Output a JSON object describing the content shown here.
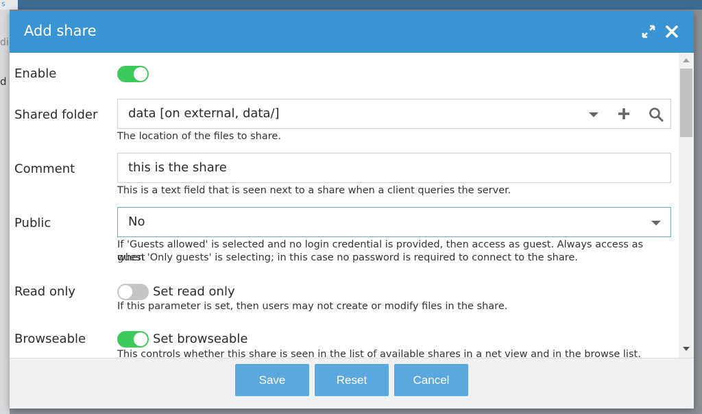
{
  "background": {
    "tab_fragment": "s",
    "side_text_1": "di",
    "side_text_2": "d"
  },
  "dialog": {
    "title": "Add share"
  },
  "form": {
    "enable": {
      "label": "Enable",
      "checked": true
    },
    "shared_folder": {
      "label": "Shared folder",
      "value": "data [on external, data/]",
      "help": "The location of the files to share."
    },
    "comment": {
      "label": "Comment",
      "value": "this is the share",
      "help": "This is a text field that is seen next to a share when a client queries the server."
    },
    "public": {
      "label": "Public",
      "value": "No",
      "help_line1": "If 'Guests allowed' is selected and no login credential is provided, then access as guest. Always access as guest",
      "help_line2": "when 'Only guests' is selecting; in this case no password is required to connect to the share."
    },
    "read_only": {
      "label": "Read only",
      "toggle_text": "Set read only",
      "checked": false,
      "help": "If this parameter is set, then users may not create or modify files in the share."
    },
    "browseable": {
      "label": "Browseable",
      "toggle_text": "Set browseable",
      "checked": true,
      "help": "This controls whether this share is seen in the list of available shares in a net view and in the browse list."
    }
  },
  "buttons": {
    "save": "Save",
    "reset": "Reset",
    "cancel": "Cancel"
  },
  "icons": {
    "expand": "expand-icon",
    "close": "close-icon",
    "dropdown": "chevron-down-icon",
    "add": "plus-icon",
    "search": "search-icon"
  },
  "colors": {
    "header": "#3a94d3",
    "toggle_on": "#3ec95c",
    "button": "#5aa8dd"
  }
}
